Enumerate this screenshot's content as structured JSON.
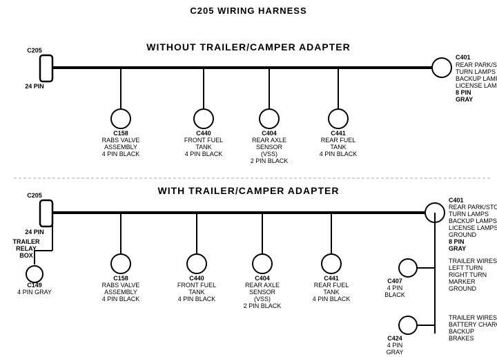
{
  "title": "C205 WIRING HARNESS",
  "section1": {
    "label": "WITHOUT  TRAILER/CAMPER ADAPTER",
    "c205": {
      "label": "C205",
      "pin_label": "24 PIN"
    },
    "c401": {
      "label": "C401",
      "pin_label": "8 PIN\nGRAY",
      "desc": "REAR PARK/STOP\nTURN LAMPS\nBACKUP LAMPS\nLICENSE LAMPS"
    },
    "connectors": [
      {
        "id": "C158",
        "label": "C158\nRABS VALVE\nASSEMBLY\n4 PIN BLACK"
      },
      {
        "id": "C440",
        "label": "C440\nFRONT FUEL\nTANK\n4 PIN BLACK"
      },
      {
        "id": "C404",
        "label": "C404\nREAR AXLE\nSENSOR\n(VSS)\n2 PIN BLACK"
      },
      {
        "id": "C441",
        "label": "C441\nREAR FUEL\nTANK\n4 PIN BLACK"
      }
    ]
  },
  "section2": {
    "label": "WITH  TRAILER/CAMPER ADAPTER",
    "c205": {
      "label": "C205",
      "pin_label": "24 PIN"
    },
    "c401": {
      "label": "C401",
      "pin_label": "8 PIN\nGRAY",
      "desc": "REAR PARK/STOP\nTURN LAMPS\nBACKUP LAMPS\nLICENSE LAMPS\nGROUND"
    },
    "c149": {
      "label": "C149\n4 PIN GRAY"
    },
    "trailer_relay": {
      "label": "TRAILER\nRELAY\nBOX"
    },
    "connectors": [
      {
        "id": "C158",
        "label": "C158\nRABS VALVE\nASSEMBLY\n4 PIN BLACK"
      },
      {
        "id": "C440",
        "label": "C440\nFRONT FUEL\nTANK\n4 PIN BLACK"
      },
      {
        "id": "C404",
        "label": "C404\nREAR AXLE\nSENSOR\n(VSS)\n2 PIN BLACK"
      },
      {
        "id": "C441",
        "label": "C441\nREAR FUEL\nTANK\n4 PIN BLACK"
      }
    ],
    "c407": {
      "label": "C407\n4 PIN\nBLACK",
      "desc": "TRAILER WIRES\nLEFT TURN\nRIGHT TURN\nMARKER\nGROUND"
    },
    "c424": {
      "label": "C424\n4 PIN\nGRAY",
      "desc": "TRAILER WIRES\nBATTERY CHARGE\nBACKUP\nBRAKES"
    }
  }
}
